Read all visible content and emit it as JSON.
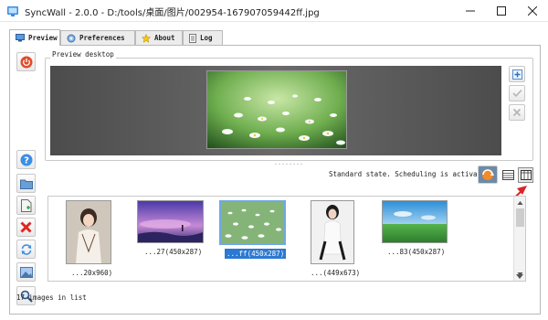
{
  "window": {
    "title": "SyncWall - 2.0.0 - D:/tools/桌面/图片/002954-167907059442ff.jpg"
  },
  "tabs": [
    {
      "label": "Preview",
      "icon": "monitor-icon"
    },
    {
      "label": "Preferences",
      "icon": "gear-icon"
    },
    {
      "label": "About",
      "icon": "star-icon"
    },
    {
      "label": "Log",
      "icon": "log-icon"
    }
  ],
  "preview": {
    "group_label": "Preview desktop"
  },
  "status": {
    "text": "Standard state. Scheduling is activated"
  },
  "images": [
    {
      "caption": "...20x960)",
      "selected": false
    },
    {
      "caption": "...27(450x287)",
      "selected": false
    },
    {
      "caption": "...ff(450x287)",
      "selected": true
    },
    {
      "caption": "...(449x673)",
      "selected": false
    },
    {
      "caption": "...83(450x287)",
      "selected": false
    }
  ],
  "footer": {
    "count_text": "17 images in list"
  },
  "colors": {
    "accent": "#2b79d3",
    "power": "#e04b2a",
    "arrow": "#d9252a"
  }
}
